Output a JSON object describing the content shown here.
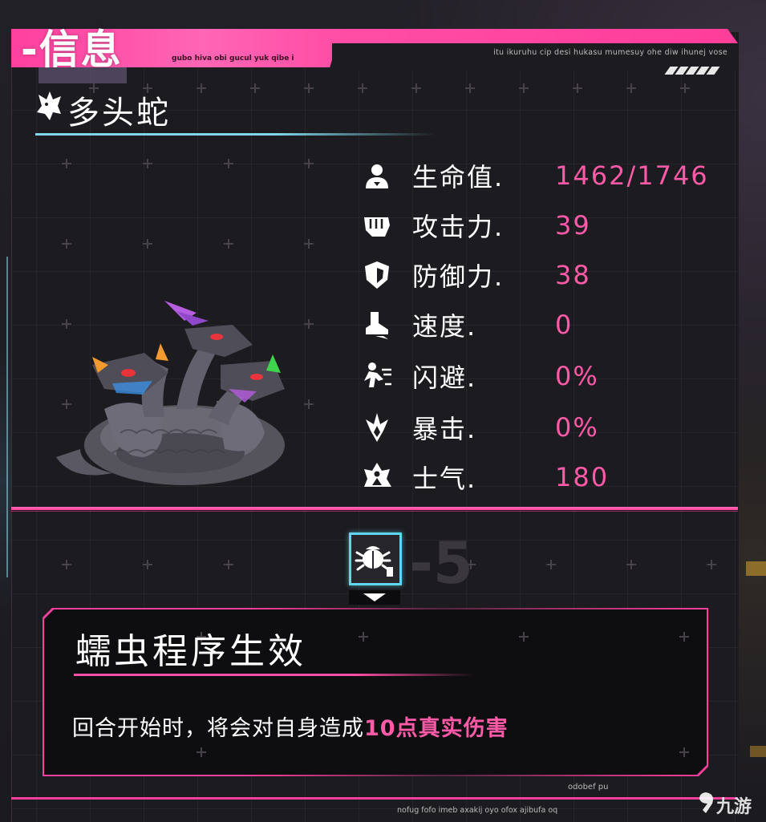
{
  "header": {
    "title": "-信息",
    "subtitle": "gubo hiva obi gucul yuk qibe i",
    "right_text": "itu ikuruhu cip desi hukasu mumesuy ohe diw ihunej vose"
  },
  "monster": {
    "name": "多头蛇",
    "icon": "beast-head-icon",
    "sprite": "hydra-sprite"
  },
  "stats": [
    {
      "icon": "person-icon",
      "label": "生命值.",
      "value": "1462/1746"
    },
    {
      "icon": "fist-icon",
      "label": "攻击力.",
      "value": "39"
    },
    {
      "icon": "shield-icon",
      "label": "防御力.",
      "value": "38"
    },
    {
      "icon": "boot-icon",
      "label": "速度.",
      "value": "0"
    },
    {
      "icon": "dodge-icon",
      "label": "闪避.",
      "value": "0%"
    },
    {
      "icon": "burst-icon",
      "label": "暴击.",
      "value": "0%"
    },
    {
      "icon": "morale-icon",
      "label": "士气.",
      "value": "180"
    }
  ],
  "effect": {
    "icon": "bug-icon",
    "ghost_number": "-5",
    "title": "蠕虫程序生效",
    "desc_prefix": "回合开始时，将会对自身造成",
    "desc_amount": "10点",
    "desc_highlight": "真实伤害"
  },
  "footer": {
    "tag": "odobef pu",
    "text": "nofug fofo imeb axakij oyo ofox ajibufa oq",
    "watermark": "九游"
  },
  "colors": {
    "accent_pink": "#ff3f9e",
    "value_pink": "#ff5aa8",
    "accent_cyan": "#7fd8ea",
    "panel_bg": "#1c1b1f"
  }
}
